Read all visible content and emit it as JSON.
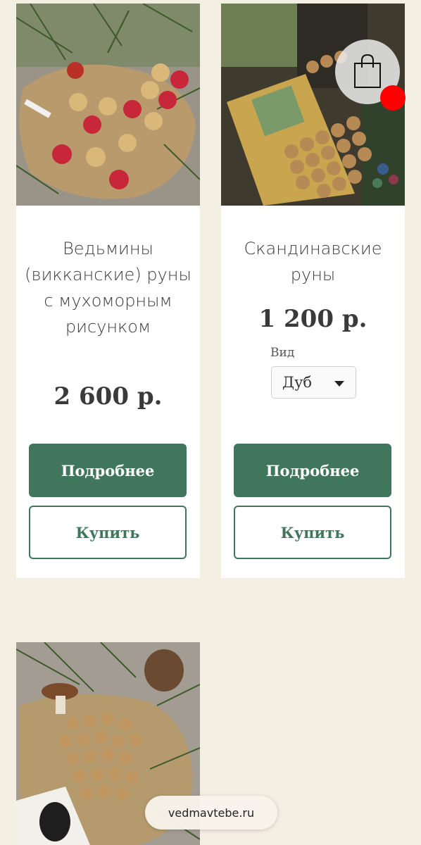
{
  "products": [
    {
      "title": "Ведьмины (викканские) руны с мухоморным рисунком",
      "price": "2 600 р.",
      "more_label": "Подробнее",
      "buy_label": "Купить"
    },
    {
      "title": "Скандинавские руны",
      "price": "1 200 р.",
      "variant_label": "Вид",
      "variant_value": "Дуб",
      "more_label": "Подробнее",
      "buy_label": "Купить"
    }
  ],
  "browser": {
    "url": "vedmavtebe.ru"
  },
  "colors": {
    "accent": "#40765c",
    "background": "#f4efe3",
    "cart_badge": "#ff0000"
  }
}
